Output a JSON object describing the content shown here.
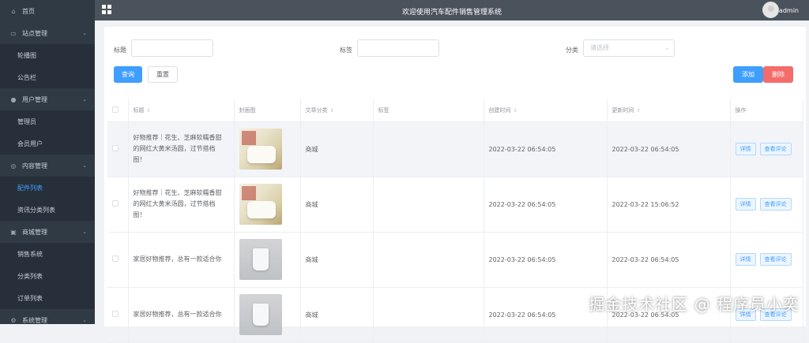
{
  "sidebar": {
    "items": [
      {
        "type": "item",
        "label": "首页",
        "icon": "home-icon"
      },
      {
        "type": "group",
        "label": "站点管理",
        "icon": "monitor-icon"
      },
      {
        "type": "sub",
        "label": "轮播图"
      },
      {
        "type": "sub",
        "label": "公告栏"
      },
      {
        "type": "group",
        "label": "用户管理",
        "icon": "user-icon"
      },
      {
        "type": "sub",
        "label": "管理员"
      },
      {
        "type": "sub",
        "label": "会员用户"
      },
      {
        "type": "group",
        "label": "内容管理",
        "icon": "content-icon"
      },
      {
        "type": "sub",
        "label": "配件列表",
        "active": true
      },
      {
        "type": "sub",
        "label": "资讯分类列表"
      },
      {
        "type": "group",
        "label": "商城管理",
        "icon": "shop-icon"
      },
      {
        "type": "sub",
        "label": "销售系统"
      },
      {
        "type": "sub",
        "label": "分类列表"
      },
      {
        "type": "sub",
        "label": "订单列表"
      },
      {
        "type": "group",
        "label": "系统管理",
        "icon": "settings-icon"
      }
    ]
  },
  "header": {
    "title": "欢迎使用汽车配件销售管理系统",
    "username": "admin"
  },
  "filters": {
    "title_label": "标题",
    "title_value": "",
    "tag_label": "标签",
    "tag_value": "",
    "category_label": "分类",
    "category_placeholder": "请选择",
    "query_button": "查询",
    "reset_button": "重置",
    "add_button": "添加",
    "delete_button": "删除"
  },
  "table": {
    "columns": [
      "标题",
      "封面图",
      "文章分类",
      "标签",
      "创建时间",
      "更新时间",
      "操作"
    ],
    "rows": [
      {
        "title": "好物推荐｜花生、芝麻软糯香甜的网红大黄米汤圆，过节搭档图！",
        "image": "food",
        "category": "商城",
        "tag": "",
        "created": "2022-03-22 06:54:05",
        "updated": "2022-03-22 06:54:05",
        "highlight": true
      },
      {
        "title": "好物推荐｜花生、芝麻软糯香甜的网红大黄米汤圆，过节搭档图！",
        "image": "food",
        "category": "商城",
        "tag": "",
        "created": "2022-03-22 06:54:05",
        "updated": "2022-03-22 15:06:52",
        "highlight": false
      },
      {
        "title": "家居好物推荐，总有一款适合你",
        "image": "cup",
        "category": "商城",
        "tag": "",
        "created": "2022-03-22 06:54:05",
        "updated": "2022-03-22 06:54:05",
        "highlight": false
      },
      {
        "title": "家居好物推荐，总有一款适合你",
        "image": "cup",
        "category": "商城",
        "tag": "",
        "created": "2022-03-22 06:54:05",
        "updated": "2022-03-22 06:54:05",
        "highlight": false
      }
    ],
    "detail_button": "详情",
    "comment_button": "查看评论"
  },
  "watermark": "掘金技术社区 @ 程序员小奕"
}
